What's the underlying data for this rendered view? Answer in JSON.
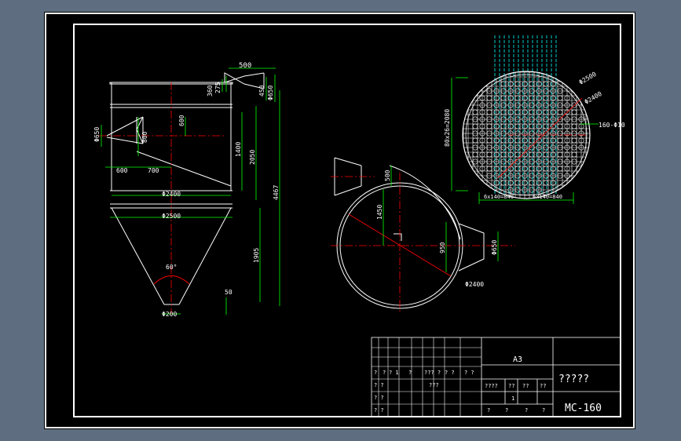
{
  "colors": {
    "background": "#5e6e80",
    "sheet": "#000000",
    "line": "#ffffff",
    "dimension": "#00ff00",
    "dim_text": "#ffffff",
    "centerline": "#ff0000",
    "tube": "#00ffff"
  },
  "front_view": {
    "dims": {
      "top_inlet_width": "500",
      "dim_360": "360",
      "dim_275": "275",
      "dim_450": "450",
      "dia_650_top": "Φ650",
      "dia_650_left": "Φ650",
      "dim_600_v": "600",
      "dim_800": "800",
      "dim_1400": "1400",
      "dim_2050": "2050",
      "dim_600_h": "600",
      "dim_700": "700",
      "dia_2400": "Φ2400",
      "dia_2500": "Φ2500",
      "total_4467": "4467",
      "dim_1905": "1905",
      "angle_60": "60°",
      "dim_50": "50",
      "dia_200": "Φ200"
    }
  },
  "top_view": {
    "dims": {
      "dim_500": "500",
      "dim_1450": "1450",
      "dim_950": "950",
      "dia_650": "Φ650",
      "dia_2400": "Φ2400"
    }
  },
  "tube_sheet": {
    "dims": {
      "dia_2500": "Φ2500",
      "dia_2400": "Φ2400",
      "bag_spec": "160-Φ10",
      "vertical": "80x26=2080",
      "bottom_left": "6x140=840",
      "bottom_right": "6x140=840"
    }
  },
  "title_block": {
    "sheet_size": "A3",
    "drawing_name": "?????",
    "drawing_number": "MC-160",
    "row1": [
      "?",
      "?",
      "? 1",
      "?",
      "??? ?",
      "? ?",
      "? ?"
    ],
    "row2_left": [
      "? ?",
      "???"
    ],
    "row3_left": [
      "? ?"
    ],
    "row4_left": [
      "? ?"
    ],
    "mid_headers": [
      "????",
      "??",
      "??",
      "??"
    ],
    "scale_value": "1",
    "bottom_row": [
      "?",
      "?",
      "?",
      "?"
    ]
  }
}
